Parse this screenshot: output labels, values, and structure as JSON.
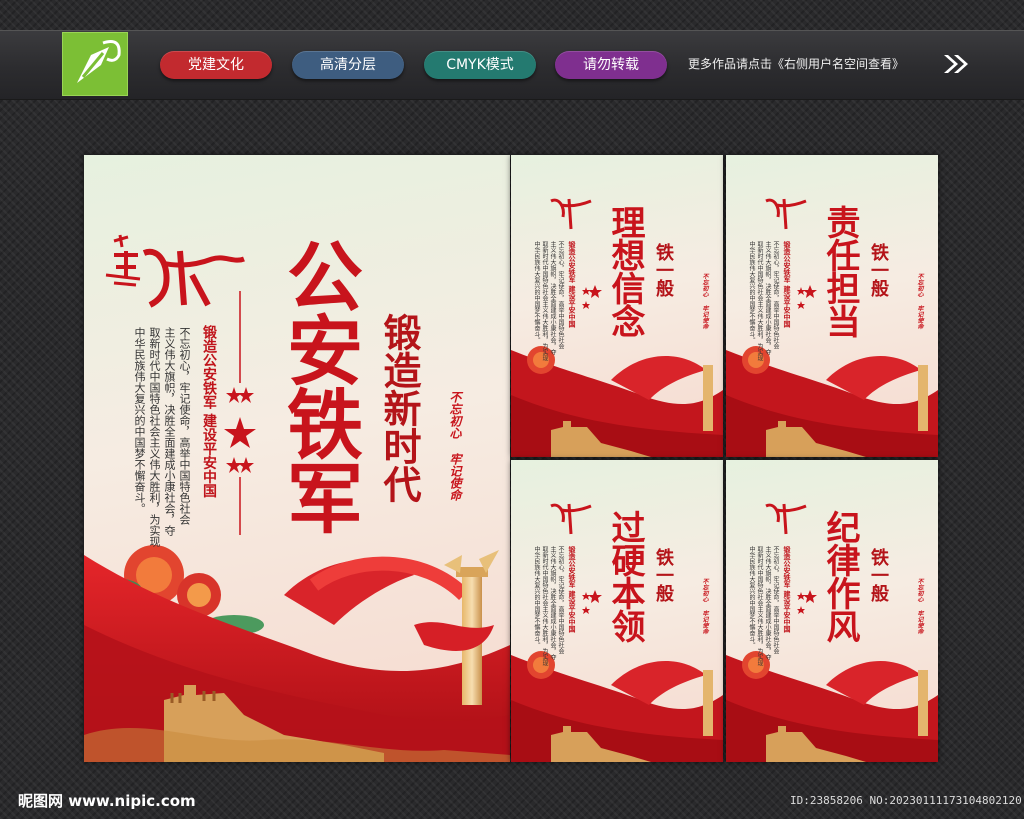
{
  "header": {
    "tags": [
      {
        "label": "党建文化",
        "color": "#c22a2f"
      },
      {
        "label": "高清分层",
        "color": "#3e5d80"
      },
      {
        "label": "CMYK模式",
        "color": "#247a70"
      },
      {
        "label": "请勿转载",
        "color": "#7f2f8f"
      }
    ],
    "note": "更多作品请点击《右侧用户名空间查看》"
  },
  "main_poster": {
    "title": "公安铁军",
    "subtitle": "锻造新时代",
    "slogan": "锻造公安铁军  建设平安中国",
    "stamp_top": "不忘初心",
    "stamp_bottom": "牢记使命",
    "body_lines": [
      "不忘初心，牢记使命，高举中国特色社会",
      "主义伟大旗帜，决胜全面建成小康社会，夺",
      "取新时代中国特色社会主义伟大胜利，为实现",
      "中华民族伟大复兴的中国梦不懈奋斗。"
    ]
  },
  "small_posters": [
    {
      "title": "理想信念",
      "badge": "铁一般"
    },
    {
      "title": "责任担当",
      "badge": "铁一般"
    },
    {
      "title": "过硬本领",
      "badge": "铁一般"
    },
    {
      "title": "纪律作风",
      "badge": "铁一般"
    }
  ],
  "small_common": {
    "slogan": "锻造公安铁军  建设平安中国",
    "stamp_top": "不忘初心",
    "stamp_bottom": "牢记使命",
    "body_lines": [
      "不忘初心，牢记使命，高举中国特色社会",
      "主义伟大旗帜，决胜全面建成小康社会，夺",
      "取新时代中国特色社会主义伟大胜利，为实现",
      "中华民族伟大复兴的中国梦不懈奋斗。"
    ]
  },
  "footer": {
    "site": "昵图网 www.nipic.com",
    "id": "ID:23858206 NO:20230111173104802120"
  }
}
